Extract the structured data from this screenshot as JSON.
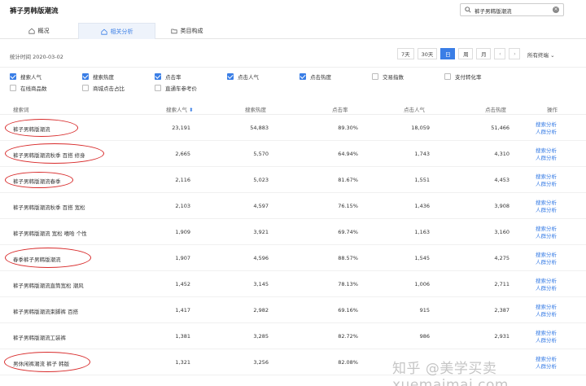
{
  "page": {
    "title": "裤子男韩版潮流"
  },
  "search": {
    "value": "裤子男韩版潮流"
  },
  "tabs": [
    {
      "label": "概况",
      "icon": "home-icon"
    },
    {
      "label": "相关分析",
      "icon": "home-icon",
      "active": true
    },
    {
      "label": "类目构成",
      "icon": "folder-icon"
    }
  ],
  "toolbar": {
    "stat_time": "统计时间 2020-03-02",
    "periods": [
      "7天",
      "30天",
      "日",
      "周",
      "月"
    ],
    "active_period": "日",
    "terminal": "所有终端"
  },
  "metrics": [
    {
      "label": "搜索人气",
      "checked": true
    },
    {
      "label": "搜索热度",
      "checked": true
    },
    {
      "label": "点击率",
      "checked": true
    },
    {
      "label": "点击人气",
      "checked": true
    },
    {
      "label": "点击热度",
      "checked": true
    },
    {
      "label": "交易指数",
      "checked": false
    },
    {
      "label": "支付转化率",
      "checked": false
    },
    {
      "label": "在线商品数",
      "checked": false
    },
    {
      "label": "商城点击占比",
      "checked": false
    },
    {
      "label": "直通车参考价",
      "checked": false
    }
  ],
  "table": {
    "headers": [
      "搜索词",
      "搜索人气",
      "搜索热度",
      "点击率",
      "点击人气",
      "点击热度",
      "操作"
    ],
    "sort_mark": "⬍",
    "action1": "搜索分析",
    "action2": "人群分析",
    "rows": [
      [
        "裤子男韩版潮流",
        "23,191",
        "54,883",
        "89.30%",
        "18,059",
        "51,466"
      ],
      [
        "裤子男韩版潮流秋季 百搭 修身",
        "2,665",
        "5,570",
        "64.94%",
        "1,743",
        "4,310"
      ],
      [
        "裤子男韩版潮流春季",
        "2,116",
        "5,023",
        "81.67%",
        "1,551",
        "4,453"
      ],
      [
        "裤子男韩版潮流秋季 百搭 宽松",
        "2,103",
        "4,597",
        "76.15%",
        "1,436",
        "3,908"
      ],
      [
        "裤子男韩版潮流 宽松 嘻哈 个性",
        "1,909",
        "3,921",
        "69.74%",
        "1,163",
        "3,160"
      ],
      [
        "春季裤子男韩版潮流",
        "1,907",
        "4,596",
        "88.57%",
        "1,545",
        "4,275"
      ],
      [
        "裤子男韩版潮流直筒宽松 潮风",
        "1,452",
        "3,145",
        "78.13%",
        "1,006",
        "2,711"
      ],
      [
        "裤子男韩版潮流束脚裤 百搭",
        "1,417",
        "2,982",
        "69.16%",
        "915",
        "2,387"
      ],
      [
        "裤子男韩版潮流工装裤",
        "1,381",
        "3,285",
        "82.72%",
        "986",
        "2,931"
      ],
      [
        "男休闲裤潮流 裤子 韩版",
        "1,321",
        "3,256",
        "82.08%",
        "",
        ""
      ]
    ]
  },
  "watermark": "知乎 @美学买卖 xuemaimai.com"
}
